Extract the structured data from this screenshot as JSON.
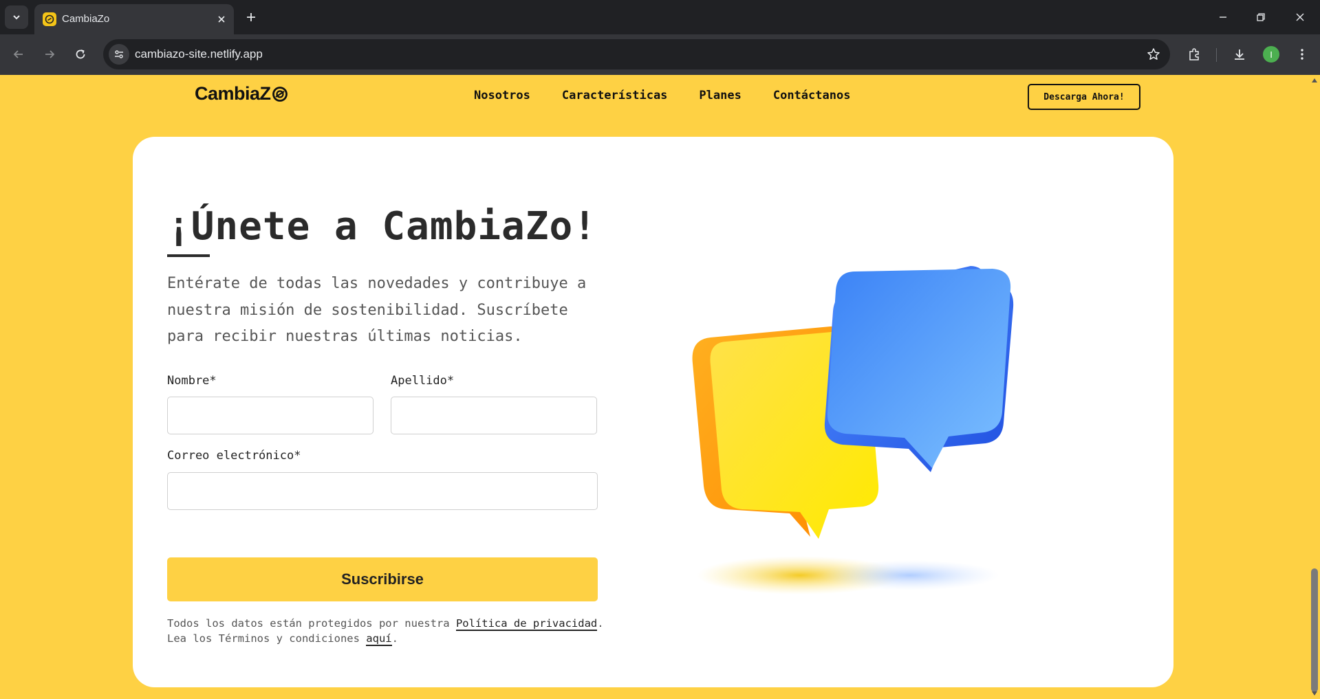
{
  "browser": {
    "tab_title": "CambiaZo",
    "url": "cambiazo-site.netlify.app",
    "profile_initial": "I"
  },
  "site": {
    "logo": "CambiaZ",
    "nav": [
      "Nosotros",
      "Características",
      "Planes",
      "Contáctanos"
    ],
    "download_button": "Descarga Ahora!"
  },
  "signup": {
    "headline": "¡Únete a CambiaZo!",
    "subtitle": "Entérate de todas las novedades y contribuye a nuestra misión de sostenibilidad. Suscríbete para recibir nuestras últimas noticias.",
    "first_name_label": "Nombre*",
    "last_name_label": "Apellido*",
    "email_label": "Correo electrónico*",
    "first_name_value": "",
    "last_name_value": "",
    "email_value": "",
    "submit_label": "Suscribirse",
    "legal_prefix": "Todos los datos están protegidos por nuestra ",
    "privacy_link": "Política de privacidad",
    "legal_middle": ". Lea los Términos y condiciones ",
    "terms_link": "aquí",
    "legal_suffix": "."
  },
  "colors": {
    "brand_yellow": "#fed144",
    "dark": "#2b2b2b",
    "bubble_blue": "#3b82f6",
    "bubble_yellow": "#fde400"
  }
}
